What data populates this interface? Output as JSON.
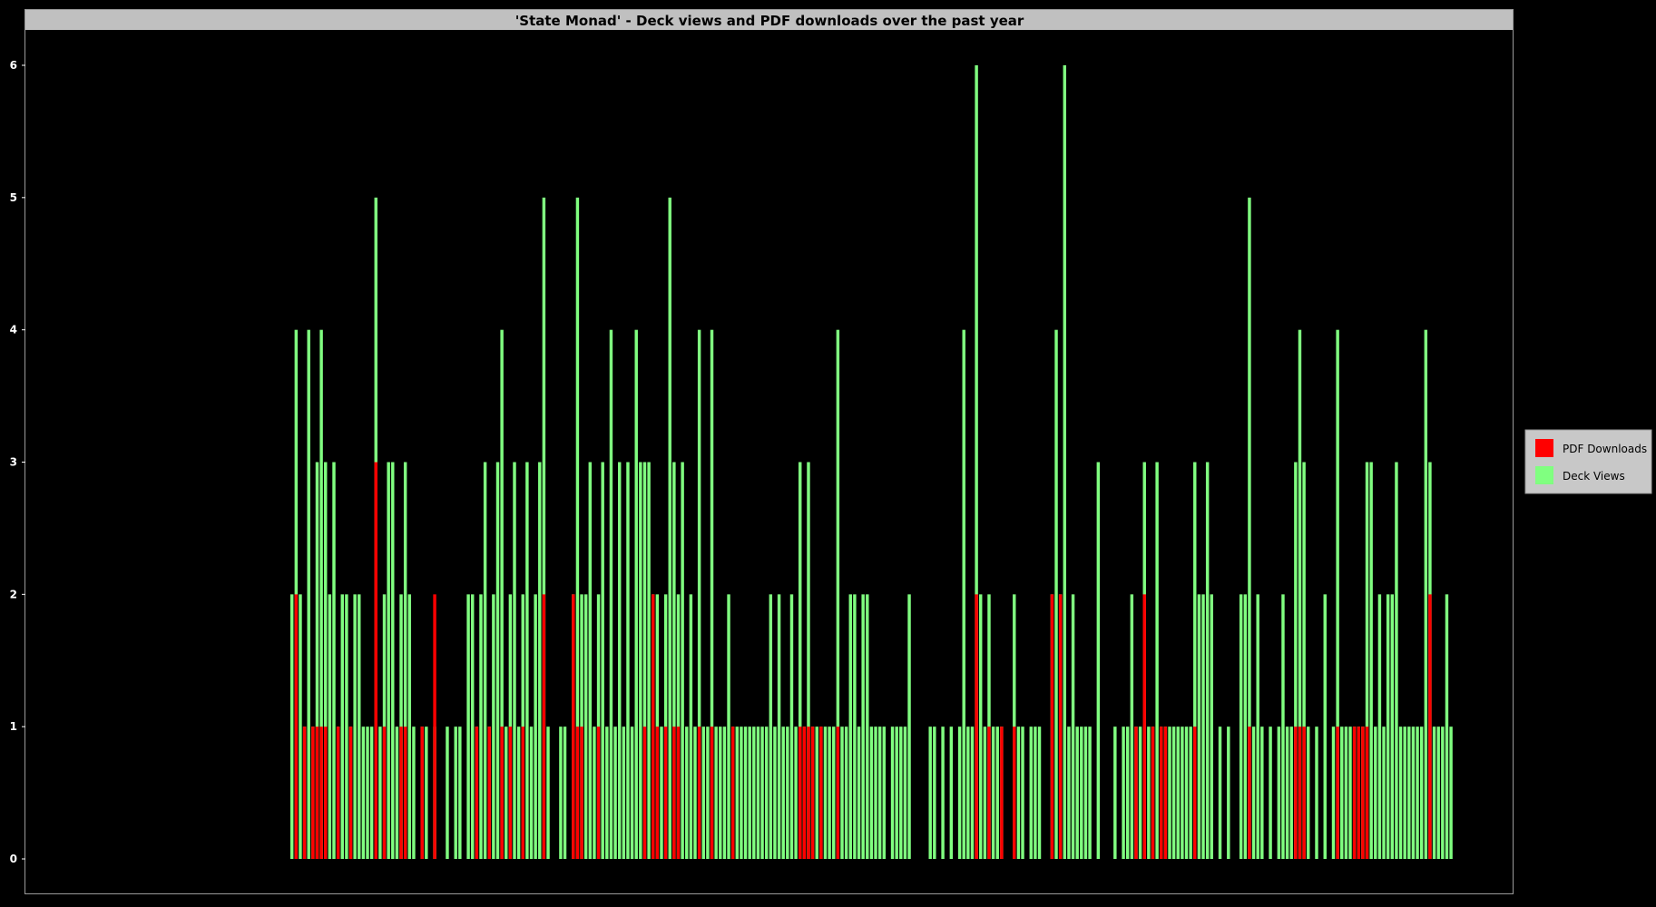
{
  "colors": {
    "background": "#000000",
    "frame": "#c0c0c0",
    "deck_views": "#80ff80",
    "pdf_downloads": "#ff0000"
  },
  "chart_data": {
    "type": "bar",
    "title": "'State Monad' - Deck views and PDF downloads over the past year",
    "xlabel": "",
    "ylabel": "",
    "ylim": [
      0,
      6.4
    ],
    "yticks": [
      0,
      1,
      2,
      3,
      4,
      5,
      6
    ],
    "grid": false,
    "legend_position": "right",
    "legend": [
      "PDF Downloads",
      "Deck Views"
    ],
    "day_start": 50,
    "days": 366,
    "series": [
      {
        "name": "Deck Views",
        "color": "#80ff80",
        "points": [
          [
            0,
            2
          ],
          [
            1,
            4
          ],
          [
            2,
            2
          ],
          [
            3,
            1
          ],
          [
            4,
            4
          ],
          [
            5,
            1
          ],
          [
            6,
            3
          ],
          [
            7,
            4
          ],
          [
            8,
            3
          ],
          [
            9,
            2
          ],
          [
            10,
            3
          ],
          [
            11,
            1
          ],
          [
            12,
            2
          ],
          [
            13,
            2
          ],
          [
            14,
            1
          ],
          [
            15,
            2
          ],
          [
            16,
            2
          ],
          [
            17,
            1
          ],
          [
            18,
            1
          ],
          [
            19,
            1
          ],
          [
            20,
            5
          ],
          [
            21,
            1
          ],
          [
            22,
            2
          ],
          [
            23,
            3
          ],
          [
            24,
            3
          ],
          [
            25,
            1
          ],
          [
            26,
            2
          ],
          [
            27,
            3
          ],
          [
            28,
            2
          ],
          [
            29,
            1
          ],
          [
            31,
            1
          ],
          [
            32,
            1
          ],
          [
            34,
            1
          ],
          [
            37,
            1
          ],
          [
            39,
            1
          ],
          [
            40,
            1
          ],
          [
            42,
            2
          ],
          [
            43,
            2
          ],
          [
            44,
            1
          ],
          [
            45,
            2
          ],
          [
            46,
            3
          ],
          [
            47,
            1
          ],
          [
            48,
            2
          ],
          [
            49,
            3
          ],
          [
            50,
            4
          ],
          [
            51,
            1
          ],
          [
            52,
            2
          ],
          [
            53,
            3
          ],
          [
            54,
            1
          ],
          [
            55,
            2
          ],
          [
            56,
            3
          ],
          [
            57,
            1
          ],
          [
            58,
            2
          ],
          [
            59,
            3
          ],
          [
            60,
            5
          ],
          [
            61,
            1
          ],
          [
            64,
            1
          ],
          [
            65,
            1
          ],
          [
            67,
            2
          ],
          [
            68,
            5
          ],
          [
            69,
            2
          ],
          [
            70,
            2
          ],
          [
            71,
            3
          ],
          [
            72,
            1
          ],
          [
            73,
            2
          ],
          [
            74,
            3
          ],
          [
            75,
            1
          ],
          [
            76,
            4
          ],
          [
            77,
            1
          ],
          [
            78,
            3
          ],
          [
            79,
            1
          ],
          [
            80,
            3
          ],
          [
            81,
            1
          ],
          [
            82,
            4
          ],
          [
            83,
            3
          ],
          [
            84,
            3
          ],
          [
            85,
            3
          ],
          [
            86,
            2
          ],
          [
            87,
            2
          ],
          [
            88,
            1
          ],
          [
            89,
            2
          ],
          [
            90,
            5
          ],
          [
            91,
            3
          ],
          [
            92,
            2
          ],
          [
            93,
            3
          ],
          [
            94,
            1
          ],
          [
            95,
            2
          ],
          [
            96,
            1
          ],
          [
            97,
            4
          ],
          [
            98,
            1
          ],
          [
            99,
            1
          ],
          [
            100,
            4
          ],
          [
            101,
            1
          ],
          [
            102,
            1
          ],
          [
            103,
            1
          ],
          [
            104,
            2
          ],
          [
            105,
            1
          ],
          [
            106,
            1
          ],
          [
            107,
            1
          ],
          [
            108,
            1
          ],
          [
            109,
            1
          ],
          [
            110,
            1
          ],
          [
            111,
            1
          ],
          [
            112,
            1
          ],
          [
            113,
            1
          ],
          [
            114,
            2
          ],
          [
            115,
            1
          ],
          [
            116,
            2
          ],
          [
            117,
            1
          ],
          [
            118,
            1
          ],
          [
            119,
            2
          ],
          [
            120,
            1
          ],
          [
            121,
            3
          ],
          [
            122,
            1
          ],
          [
            123,
            3
          ],
          [
            124,
            1
          ],
          [
            125,
            1
          ],
          [
            126,
            1
          ],
          [
            127,
            1
          ],
          [
            128,
            1
          ],
          [
            129,
            1
          ],
          [
            130,
            4
          ],
          [
            131,
            1
          ],
          [
            132,
            1
          ],
          [
            133,
            2
          ],
          [
            134,
            2
          ],
          [
            135,
            1
          ],
          [
            136,
            2
          ],
          [
            137,
            2
          ],
          [
            138,
            1
          ],
          [
            139,
            1
          ],
          [
            140,
            1
          ],
          [
            141,
            1
          ],
          [
            143,
            1
          ],
          [
            144,
            1
          ],
          [
            145,
            1
          ],
          [
            146,
            1
          ],
          [
            147,
            2
          ],
          [
            152,
            1
          ],
          [
            153,
            1
          ],
          [
            155,
            1
          ],
          [
            157,
            1
          ],
          [
            159,
            1
          ],
          [
            160,
            4
          ],
          [
            161,
            1
          ],
          [
            162,
            1
          ],
          [
            163,
            6
          ],
          [
            164,
            2
          ],
          [
            165,
            1
          ],
          [
            166,
            2
          ],
          [
            167,
            1
          ],
          [
            168,
            1
          ],
          [
            169,
            1
          ],
          [
            172,
            2
          ],
          [
            173,
            1
          ],
          [
            174,
            1
          ],
          [
            176,
            1
          ],
          [
            177,
            1
          ],
          [
            178,
            1
          ],
          [
            181,
            2
          ],
          [
            182,
            4
          ],
          [
            183,
            2
          ],
          [
            184,
            6
          ],
          [
            185,
            1
          ],
          [
            186,
            2
          ],
          [
            187,
            1
          ],
          [
            188,
            1
          ],
          [
            189,
            1
          ],
          [
            190,
            1
          ],
          [
            192,
            3
          ],
          [
            196,
            1
          ],
          [
            198,
            1
          ],
          [
            199,
            1
          ],
          [
            200,
            2
          ],
          [
            201,
            1
          ],
          [
            202,
            1
          ],
          [
            203,
            3
          ],
          [
            204,
            1
          ],
          [
            205,
            1
          ],
          [
            206,
            3
          ],
          [
            207,
            1
          ],
          [
            208,
            1
          ],
          [
            209,
            1
          ],
          [
            210,
            1
          ],
          [
            211,
            1
          ],
          [
            212,
            1
          ],
          [
            213,
            1
          ],
          [
            214,
            1
          ],
          [
            215,
            3
          ],
          [
            216,
            2
          ],
          [
            217,
            2
          ],
          [
            218,
            3
          ],
          [
            219,
            2
          ],
          [
            221,
            1
          ],
          [
            223,
            1
          ],
          [
            226,
            2
          ],
          [
            227,
            2
          ],
          [
            228,
            5
          ],
          [
            229,
            1
          ],
          [
            230,
            2
          ],
          [
            231,
            1
          ],
          [
            233,
            1
          ],
          [
            235,
            1
          ],
          [
            236,
            2
          ],
          [
            237,
            1
          ],
          [
            238,
            1
          ],
          [
            239,
            3
          ],
          [
            240,
            4
          ],
          [
            241,
            3
          ],
          [
            242,
            1
          ],
          [
            244,
            1
          ],
          [
            246,
            2
          ],
          [
            248,
            1
          ],
          [
            249,
            4
          ],
          [
            250,
            1
          ],
          [
            251,
            1
          ],
          [
            252,
            1
          ],
          [
            253,
            1
          ],
          [
            254,
            1
          ],
          [
            255,
            1
          ],
          [
            256,
            3
          ],
          [
            257,
            3
          ],
          [
            258,
            1
          ],
          [
            259,
            2
          ],
          [
            260,
            1
          ],
          [
            261,
            2
          ],
          [
            262,
            2
          ],
          [
            263,
            3
          ],
          [
            264,
            1
          ],
          [
            265,
            1
          ],
          [
            266,
            1
          ],
          [
            267,
            1
          ],
          [
            268,
            1
          ],
          [
            269,
            1
          ],
          [
            270,
            4
          ],
          [
            271,
            3
          ],
          [
            272,
            1
          ],
          [
            273,
            1
          ],
          [
            274,
            1
          ],
          [
            275,
            2
          ],
          [
            276,
            1
          ]
        ]
      },
      {
        "name": "PDF Downloads",
        "color": "#ff0000",
        "points": [
          [
            1,
            2
          ],
          [
            3,
            1
          ],
          [
            5,
            1
          ],
          [
            6,
            1
          ],
          [
            7,
            1
          ],
          [
            8,
            1
          ],
          [
            11,
            1
          ],
          [
            14,
            1
          ],
          [
            20,
            3
          ],
          [
            22,
            1
          ],
          [
            26,
            1
          ],
          [
            27,
            1
          ],
          [
            31,
            1
          ],
          [
            34,
            2
          ],
          [
            44,
            1
          ],
          [
            47,
            1
          ],
          [
            50,
            1
          ],
          [
            52,
            1
          ],
          [
            55,
            1
          ],
          [
            60,
            2
          ],
          [
            67,
            2
          ],
          [
            68,
            1
          ],
          [
            69,
            1
          ],
          [
            73,
            1
          ],
          [
            84,
            1
          ],
          [
            86,
            2
          ],
          [
            87,
            1
          ],
          [
            89,
            1
          ],
          [
            91,
            1
          ],
          [
            92,
            1
          ],
          [
            97,
            1
          ],
          [
            100,
            1
          ],
          [
            105,
            1
          ],
          [
            121,
            1
          ],
          [
            122,
            1
          ],
          [
            123,
            1
          ],
          [
            124,
            1
          ],
          [
            126,
            1
          ],
          [
            130,
            1
          ],
          [
            163,
            2
          ],
          [
            166,
            1
          ],
          [
            169,
            1
          ],
          [
            172,
            1
          ],
          [
            181,
            2
          ],
          [
            183,
            2
          ],
          [
            201,
            1
          ],
          [
            203,
            2
          ],
          [
            205,
            1
          ],
          [
            207,
            1
          ],
          [
            208,
            1
          ],
          [
            215,
            1
          ],
          [
            228,
            1
          ],
          [
            239,
            1
          ],
          [
            240,
            1
          ],
          [
            241,
            1
          ],
          [
            249,
            1
          ],
          [
            253,
            1
          ],
          [
            254,
            1
          ],
          [
            255,
            1
          ],
          [
            256,
            1
          ],
          [
            271,
            2
          ]
        ]
      }
    ]
  }
}
